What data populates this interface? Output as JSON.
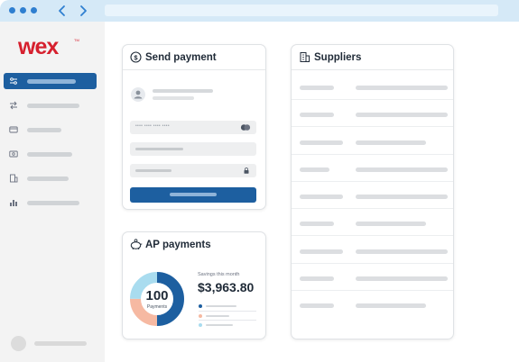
{
  "browser": {
    "back_icon": "chevron-left-icon",
    "forward_icon": "chevron-right-icon",
    "accent": "#2f7fd0"
  },
  "brand": {
    "logo_text": "wex",
    "logo_color": "#d6202e",
    "primary_color": "#1d5fa0"
  },
  "sidebar": {
    "items": [
      {
        "icon": "sliders-icon",
        "active": true
      },
      {
        "icon": "transfer-arrows-icon",
        "active": false
      },
      {
        "icon": "credit-card-icon",
        "active": false
      },
      {
        "icon": "cash-icon",
        "active": false
      },
      {
        "icon": "building-icon",
        "active": false
      },
      {
        "icon": "bar-chart-icon",
        "active": false
      }
    ]
  },
  "send_payment": {
    "title": "Send payment",
    "icon": "dollar-circle-icon",
    "card_number_mask": "•••• •••• •••• ••••",
    "card_brand_icon": "mastercard-icon",
    "lock_icon": "lock-icon"
  },
  "ap_payments": {
    "title": "AP payments",
    "icon": "piggy-bank-icon",
    "donut_value": "100",
    "donut_label": "Payments",
    "savings_label": "Savings this month",
    "savings_amount": "$3,963.80",
    "segments": [
      {
        "color": "#1d5fa0",
        "fraction": 0.5
      },
      {
        "color": "#f6b9a2",
        "fraction": 0.25
      },
      {
        "color": "#a9dcef",
        "fraction": 0.25
      }
    ]
  },
  "suppliers": {
    "title": "Suppliers",
    "icon": "building-icon"
  }
}
